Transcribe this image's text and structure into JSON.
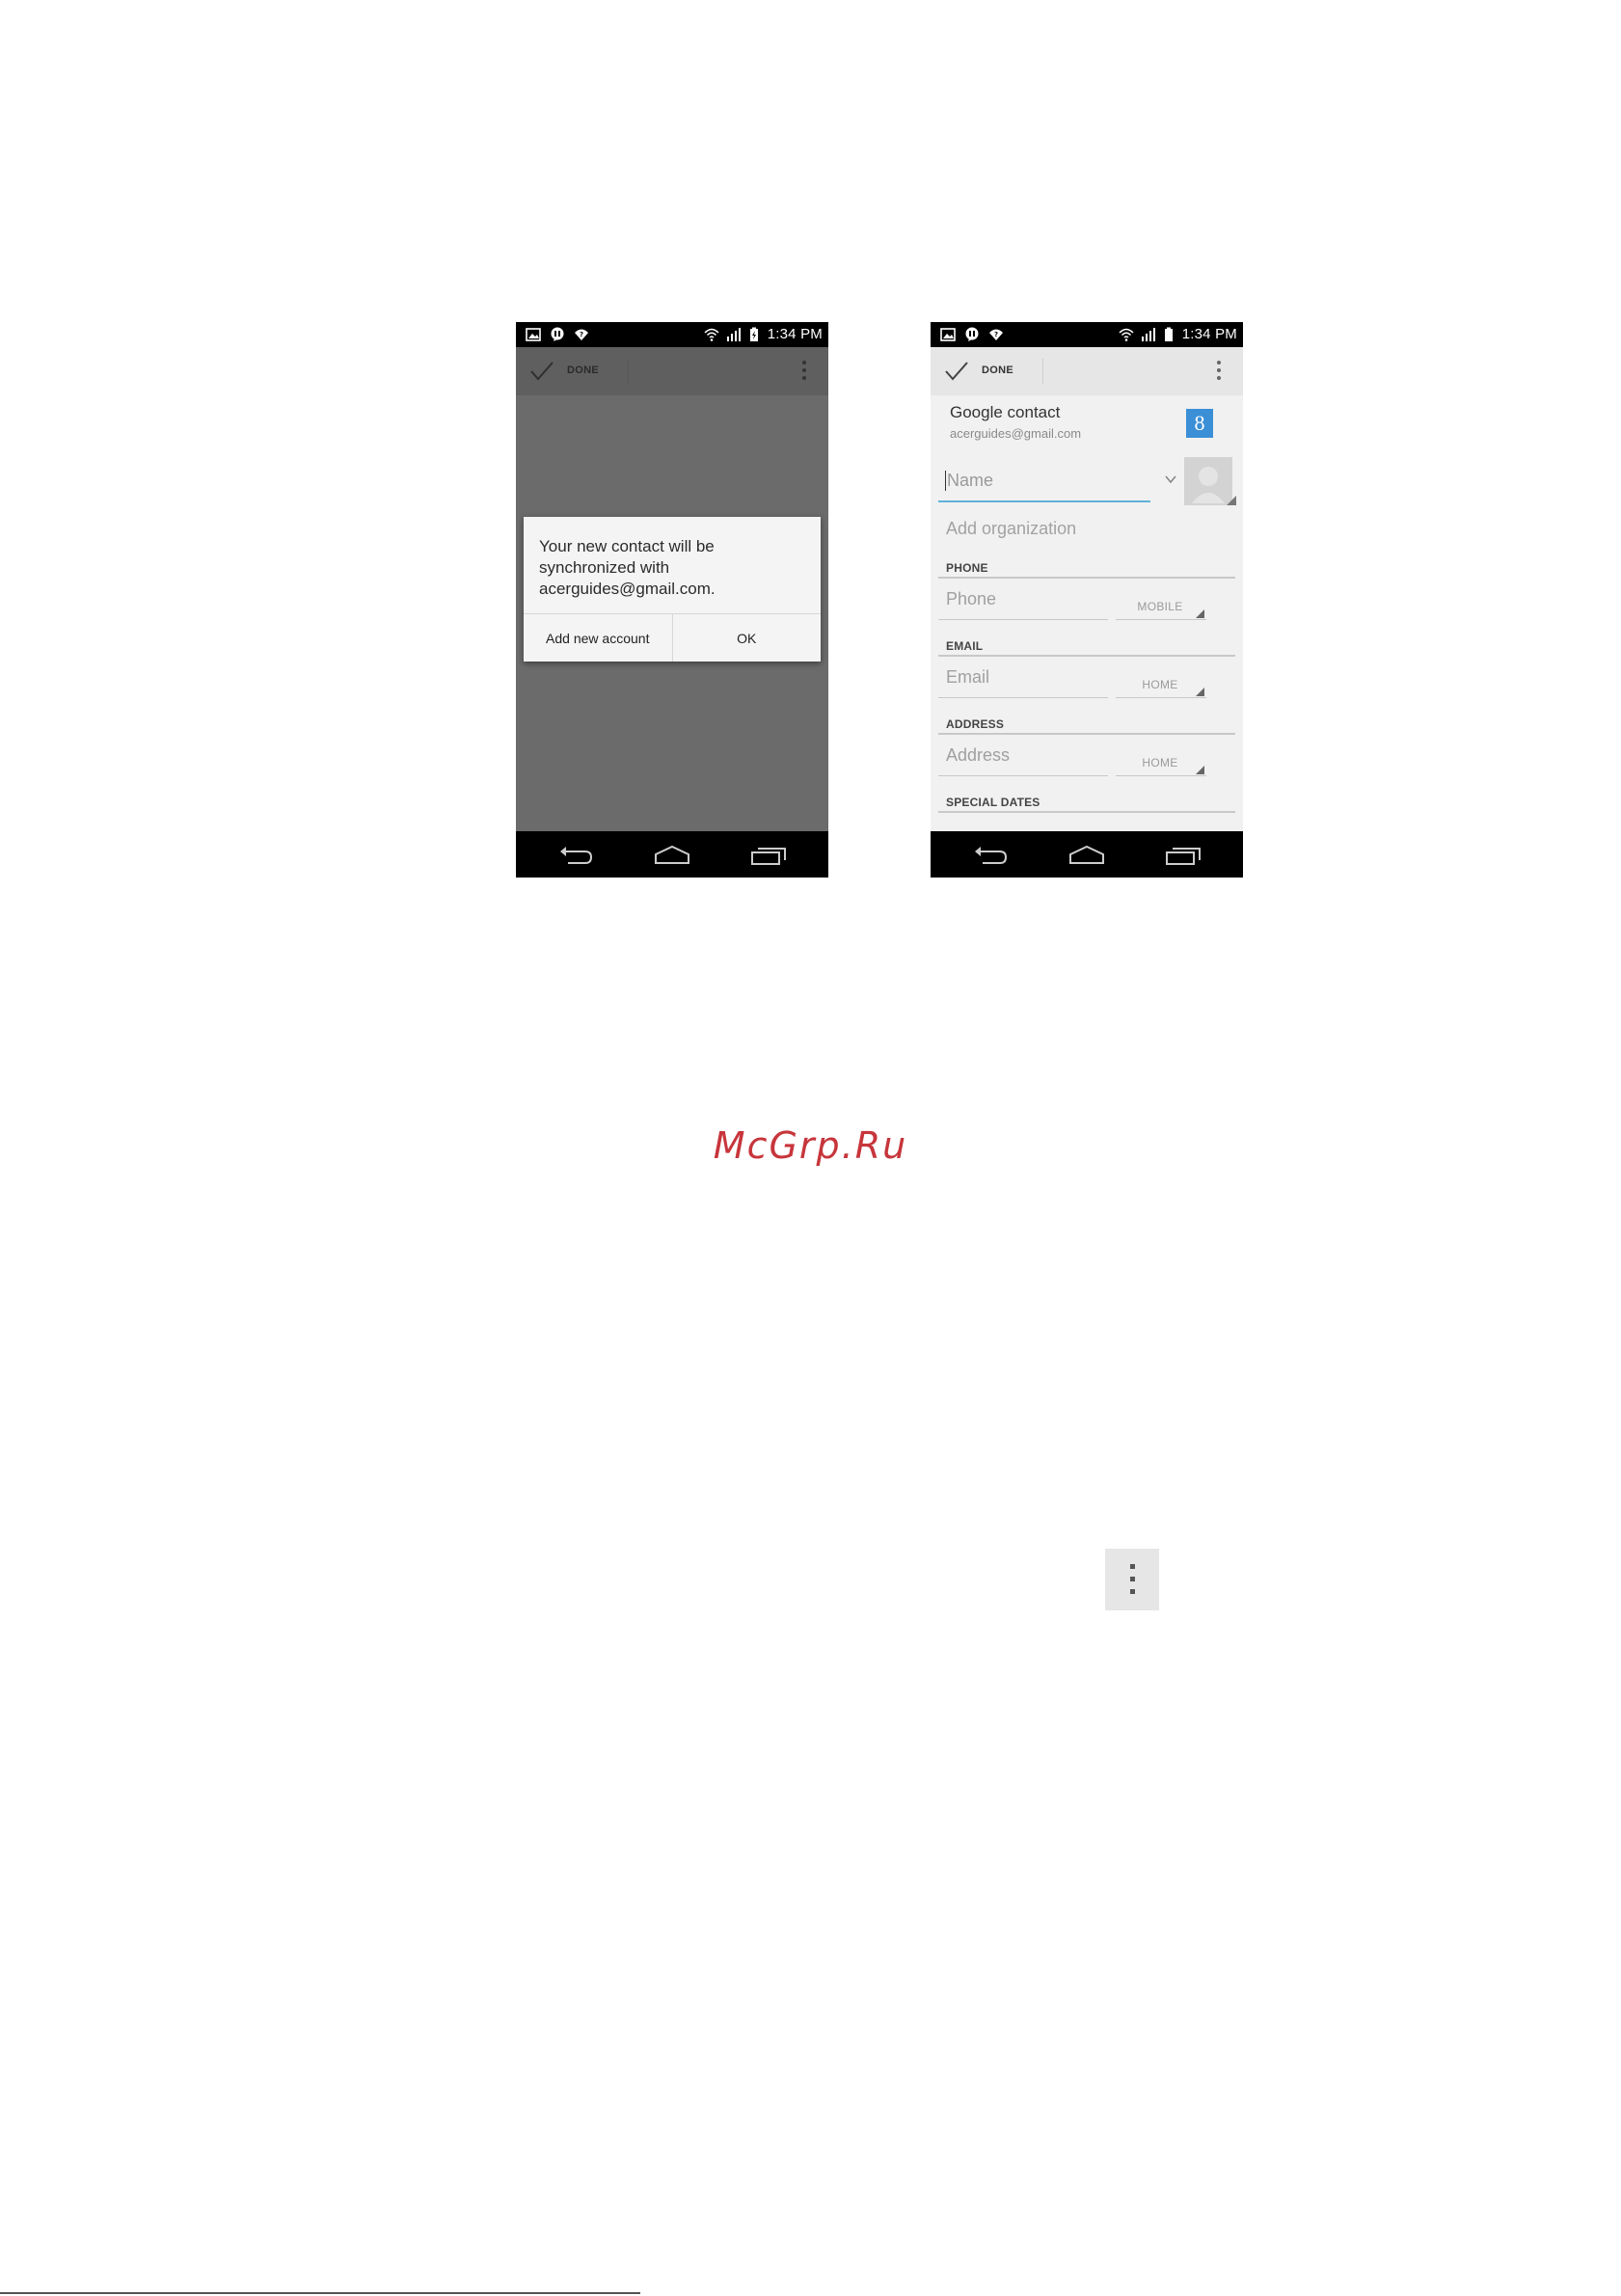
{
  "phone_left": {
    "status_bar": {
      "time": "1:34 PM",
      "left_icons": [
        "image-icon",
        "chat-icon",
        "wifi-question-icon"
      ],
      "right_icons": [
        "wifi-icon",
        "signal-icon",
        "battery-charging-icon"
      ]
    },
    "action_bar": {
      "done_label": "DONE",
      "overflow_icon": "overflow-menu-icon"
    },
    "dialog": {
      "message": "Your new contact will be synchronized with acerguides@gmail.com.",
      "buttons": [
        "Add new account",
        "OK"
      ]
    },
    "nav_bar": {
      "icons": [
        "back-icon",
        "home-icon",
        "recents-icon"
      ]
    }
  },
  "phone_right": {
    "status_bar": {
      "time": "1:34 PM",
      "left_icons": [
        "image-icon",
        "chat-icon",
        "wifi-question-icon"
      ],
      "right_icons": [
        "wifi-icon",
        "signal-icon",
        "battery-icon"
      ]
    },
    "action_bar": {
      "done_label": "DONE",
      "overflow_icon": "overflow-menu-icon"
    },
    "account": {
      "title": "Google contact",
      "email": "acerguides@gmail.com",
      "badge": "8"
    },
    "name_placeholder": "Name",
    "add_organization": "Add organization",
    "sections": [
      {
        "header": "PHONE",
        "placeholder": "Phone",
        "type": "MOBILE"
      },
      {
        "header": "EMAIL",
        "placeholder": "Email",
        "type": "HOME"
      },
      {
        "header": "ADDRESS",
        "placeholder": "Address",
        "type": "HOME"
      },
      {
        "header": "SPECIAL DATES"
      }
    ],
    "nav_bar": {
      "icons": [
        "back-icon",
        "home-icon",
        "recents-icon"
      ]
    }
  },
  "watermark": "McGrp.Ru",
  "colors": {
    "watermark": "#c7353b",
    "dim_background": "#6b6b6b",
    "input_focus": "#5fb3d8",
    "google_badge": "#3b8fd6"
  }
}
